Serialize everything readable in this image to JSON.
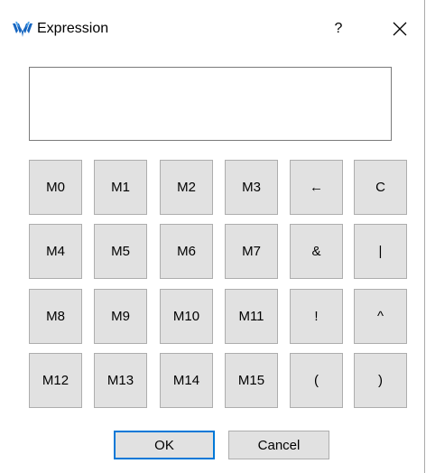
{
  "window": {
    "title": "Expression",
    "help_label": "?",
    "app_icon": "wing-logo-icon",
    "close_icon": "close-icon"
  },
  "expression": {
    "value": "",
    "placeholder": ""
  },
  "keypad": {
    "rows": [
      [
        "M0",
        "M1",
        "M2",
        "M3",
        "←",
        "C"
      ],
      [
        "M4",
        "M5",
        "M6",
        "M7",
        "&",
        "|"
      ],
      [
        "M8",
        "M9",
        "M10",
        "M11",
        "!",
        "^"
      ],
      [
        "M12",
        "M13",
        "M14",
        "M15",
        "(",
        ")"
      ]
    ]
  },
  "footer": {
    "ok_label": "OK",
    "cancel_label": "Cancel"
  },
  "colors": {
    "accent": "#0078d7",
    "button_face": "#e1e1e1",
    "button_border": "#adadad",
    "logo": "#1565c0"
  }
}
